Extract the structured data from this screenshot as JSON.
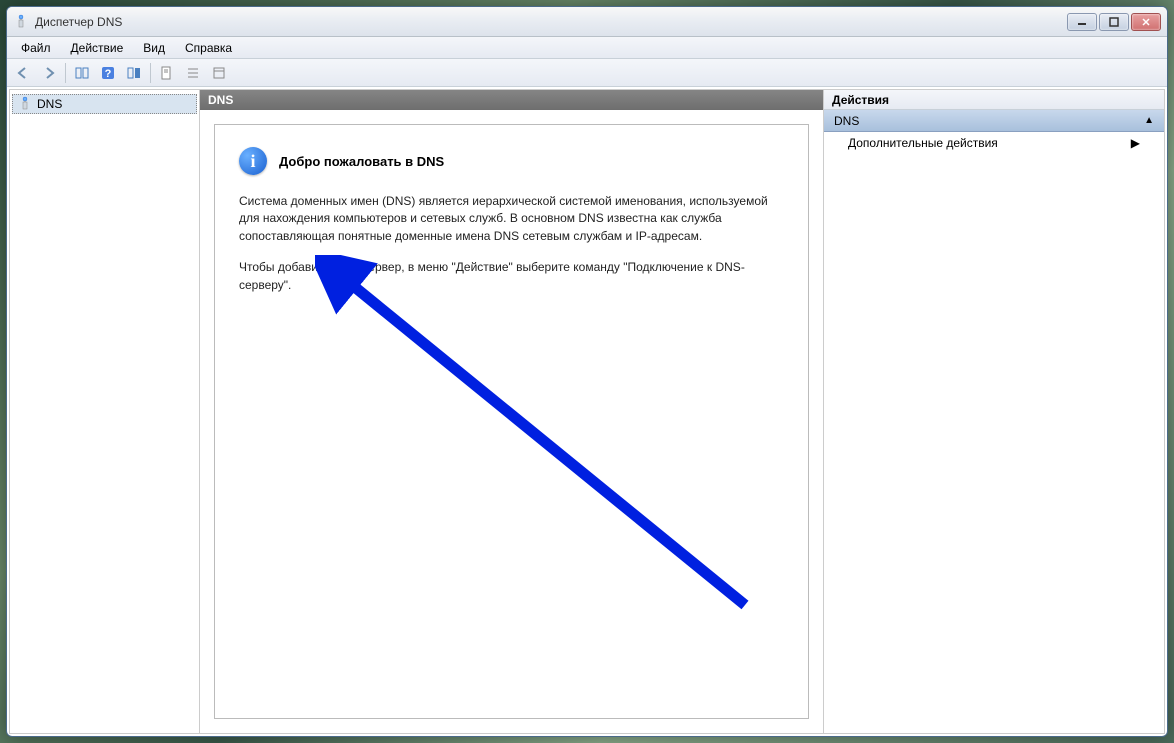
{
  "window": {
    "title": "Диспетчер DNS"
  },
  "menubar": {
    "file": "Файл",
    "action": "Действие",
    "view": "Вид",
    "help": "Справка"
  },
  "tree": {
    "root": "DNS"
  },
  "main": {
    "header": "DNS",
    "welcome_title": "Добро пожаловать в DNS",
    "para1": "Система доменных имен (DNS) является иерархической системой именования, используемой для нахождения компьютеров и сетевых служб. В основном DNS известна как служба сопоставляющая понятные доменные имена DNS сетевым службам и IP-адресам.",
    "para2": "Чтобы добавить DNS-сервер, в меню \"Действие\" выберите команду \"Подключение к DNS-серверу\"."
  },
  "actions": {
    "header": "Действия",
    "subheader": "DNS",
    "more": "Дополнительные действия"
  }
}
